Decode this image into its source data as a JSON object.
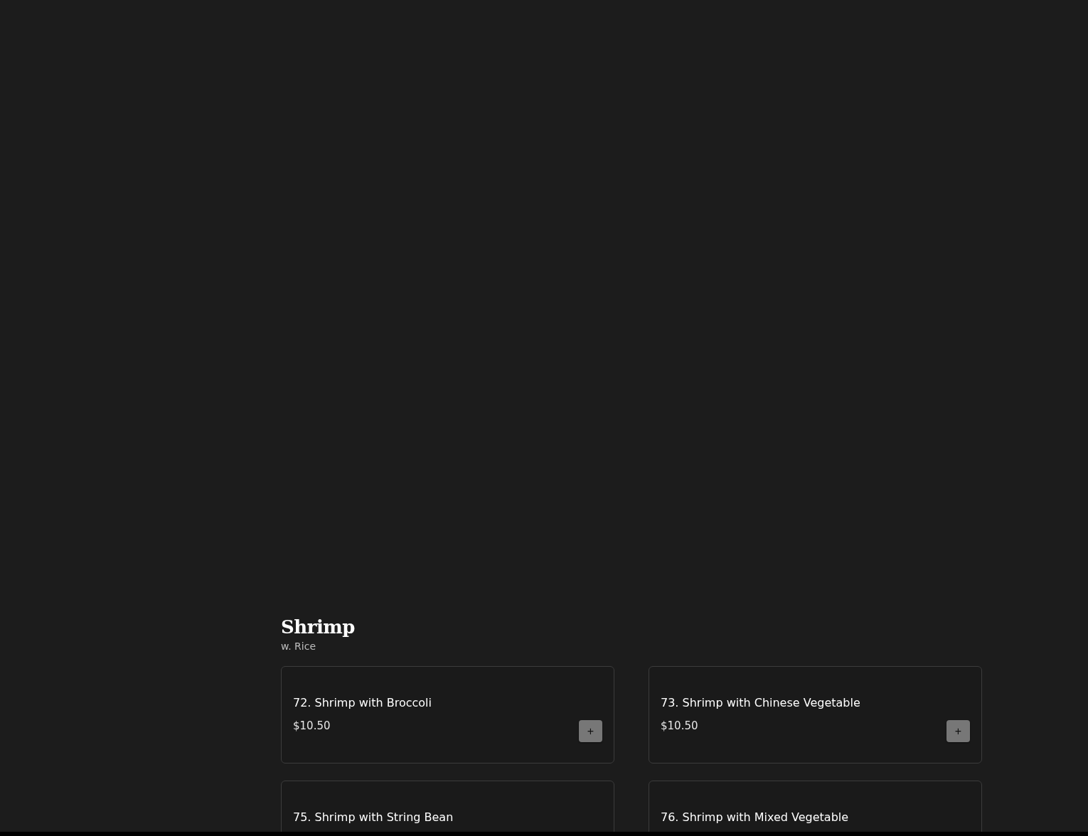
{
  "section": {
    "title": "Shrimp",
    "subtitle": "w. Rice"
  },
  "items": [
    {
      "name": "72. Shrimp with Broccoli",
      "price": "$10.50",
      "add": "+"
    },
    {
      "name": "73. Shrimp with Chinese Vegetable",
      "price": "$10.50",
      "add": "+"
    },
    {
      "name": "75. Shrimp with String Bean"
    },
    {
      "name": "76. Shrimp with Mixed Vegetable"
    }
  ]
}
